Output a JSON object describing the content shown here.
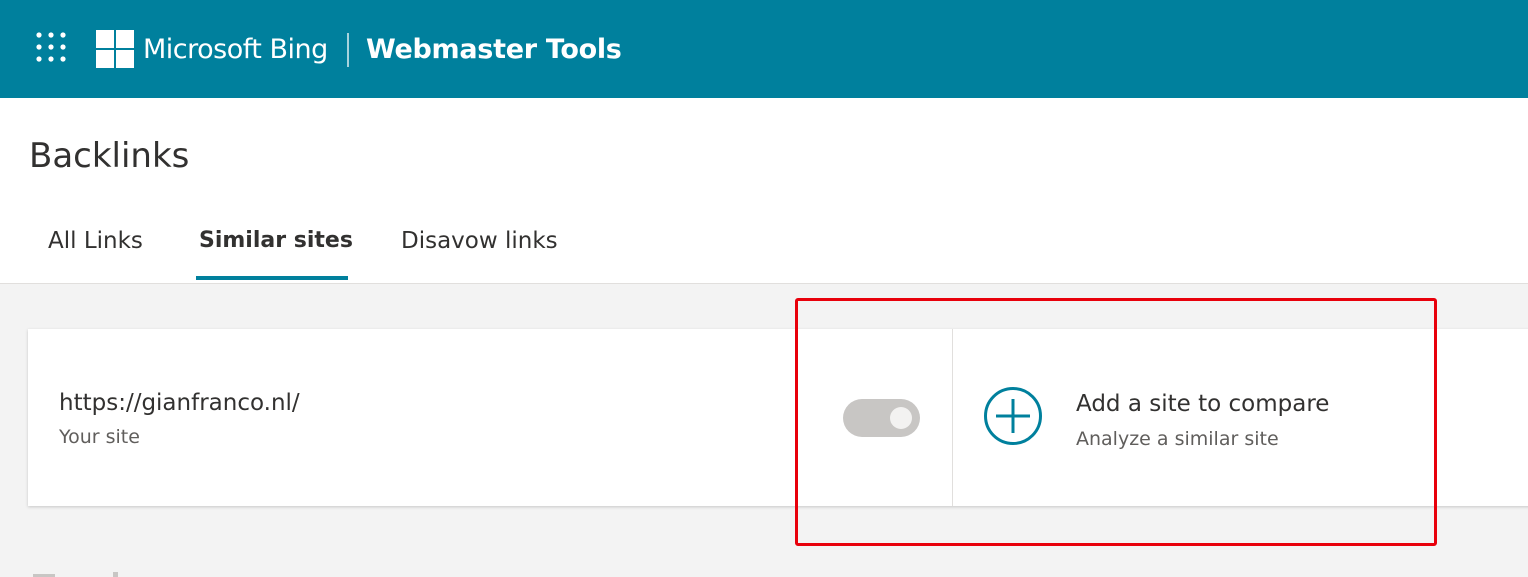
{
  "header": {
    "brand": "Microsoft Bing",
    "product": "Webmaster Tools",
    "background_color": "#00809d",
    "app_launcher_icon": "app-launcher-waffle-icon",
    "logo_icon": "microsoft-windows-logo-icon"
  },
  "page": {
    "title": "Backlinks",
    "tabs": [
      {
        "label": "All Links",
        "selected": false
      },
      {
        "label": "Similar sites",
        "selected": true
      },
      {
        "label": "Disavow links",
        "selected": false
      }
    ],
    "accent_color": "#00809d"
  },
  "comparison": {
    "your_site": {
      "url": "https://gianfranco.nl/",
      "label": "Your site",
      "toggle_state": "off"
    },
    "add_site": {
      "title": "Add a site to compare",
      "subtitle": "Analyze a similar site",
      "icon": "add-circle-icon"
    }
  },
  "annotation": {
    "highlight_color": "#e8000b"
  }
}
